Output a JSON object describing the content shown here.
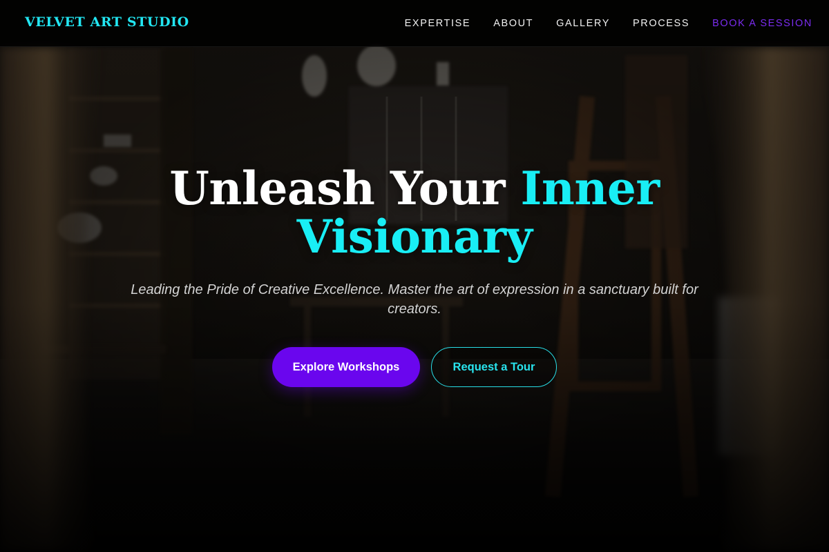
{
  "header": {
    "brand": "VELVET ART STUDIO",
    "nav": [
      {
        "label": "EXPERTISE"
      },
      {
        "label": "ABOUT"
      },
      {
        "label": "GALLERY"
      },
      {
        "label": "PROCESS"
      }
    ],
    "cta_label": "BOOK A SESSION"
  },
  "hero": {
    "title_plain": "Unleash Your",
    "title_accent_line1": "Inner",
    "title_accent_line2": "Visionary",
    "subtitle": "Leading the Pride of Creative Excellence. Master the art of expression in a sanctuary built for creators.",
    "primary_button": "Explore Workshops",
    "secondary_button": "Request a Tour"
  },
  "colors": {
    "accent_cyan": "#19eef5",
    "accent_purple": "#6a06ee",
    "header_bg": "#000000",
    "text_light": "#ffffff"
  }
}
